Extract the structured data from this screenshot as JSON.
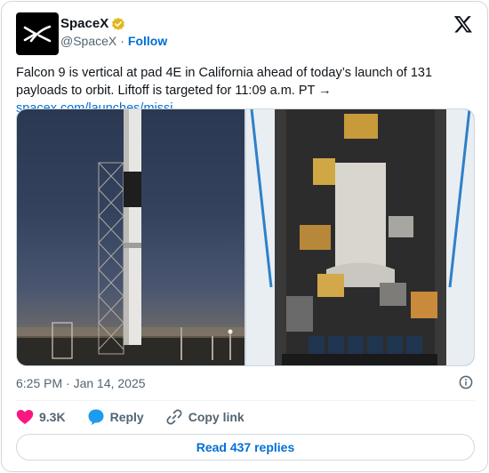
{
  "author": {
    "display_name": "SpaceX",
    "handle": "@SpaceX",
    "separator": "·",
    "follow_label": "Follow",
    "verified_color": "#e2b719"
  },
  "tweet": {
    "text": "Falcon 9 is vertical at pad 4E in California ahead of today’s launch of 131 payloads to orbit. Liftoff is targeted for 11:09 a.m. PT → ",
    "link_text": "spacex.com/launches/missi…",
    "timestamp": "6:25 PM · Jan 14, 2025"
  },
  "media": {
    "photos": [
      "falcon-9-on-pad",
      "payload-stack"
    ]
  },
  "actions": {
    "like_count": "9.3K",
    "reply_label": "Reply",
    "copy_link_label": "Copy link"
  },
  "footer": {
    "read_replies_label": "Read 437 replies"
  },
  "colors": {
    "accent": "#006fd6",
    "like": "#f91880",
    "muted": "#536471",
    "border": "#cfd9de"
  }
}
